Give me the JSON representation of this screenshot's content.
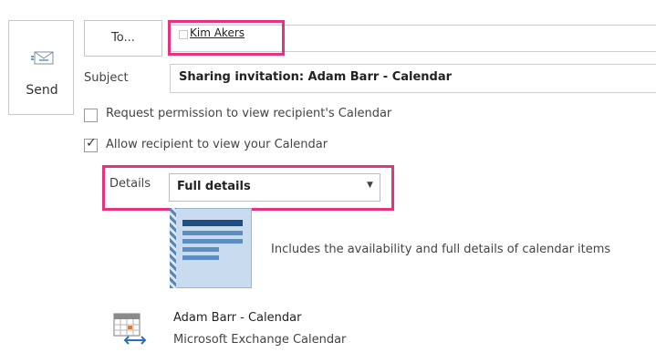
{
  "toolbar": {
    "send_label": "Send"
  },
  "to": {
    "button_label": "To...",
    "recipient": "Kim Akers"
  },
  "subject": {
    "label": "Subject",
    "value": "Sharing invitation: Adam Barr - Calendar"
  },
  "options": {
    "request_permission": {
      "label": "Request permission to view recipient's Calendar",
      "checked": false
    },
    "allow_view": {
      "label": "Allow recipient to view your Calendar",
      "checked": true
    }
  },
  "details": {
    "label": "Details",
    "selected": "Full details"
  },
  "preview": {
    "description": "Includes the availability and full details of calendar items"
  },
  "calendar": {
    "name": "Adam Barr - Calendar",
    "type": "Microsoft Exchange Calendar"
  },
  "colors": {
    "highlight": "#e5337f",
    "doc_accent": "#1f4f82"
  },
  "icons": {
    "send": "send-mail-icon",
    "calendar": "calendar-share-icon",
    "details_dropdown": "chevron-down-icon"
  }
}
